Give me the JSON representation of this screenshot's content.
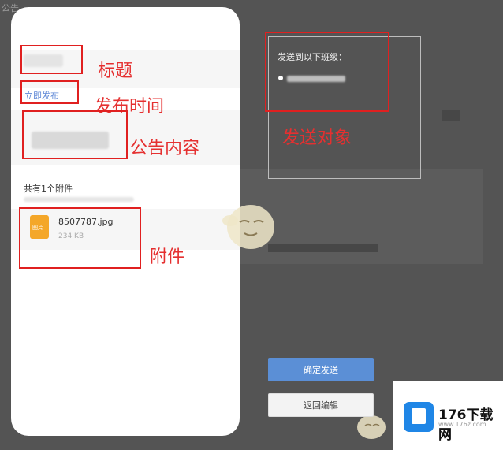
{
  "background": {
    "corner_text": "公告"
  },
  "preview": {
    "title_placeholder": "",
    "publish_link": "立即发布",
    "attachments_header": "共有1个附件",
    "file": {
      "name": "8507787.jpg",
      "size": "234 KB",
      "icon_text": "图片"
    }
  },
  "annotations": {
    "title": "标题",
    "publish_time": "发布时间",
    "content": "公告内容",
    "attachment": "附件",
    "send_target": "发送对象"
  },
  "send_panel": {
    "heading": "发送到以下班级："
  },
  "buttons": {
    "confirm": "确定发送",
    "back": "返回编辑"
  },
  "watermark": {
    "brand": "176下载网",
    "url": "www.176z.com"
  },
  "colors": {
    "annotation_red": "#e02020",
    "primary_blue": "#5b8fd6",
    "file_icon_orange": "#f4a729",
    "brand_blue": "#1f86e6"
  }
}
